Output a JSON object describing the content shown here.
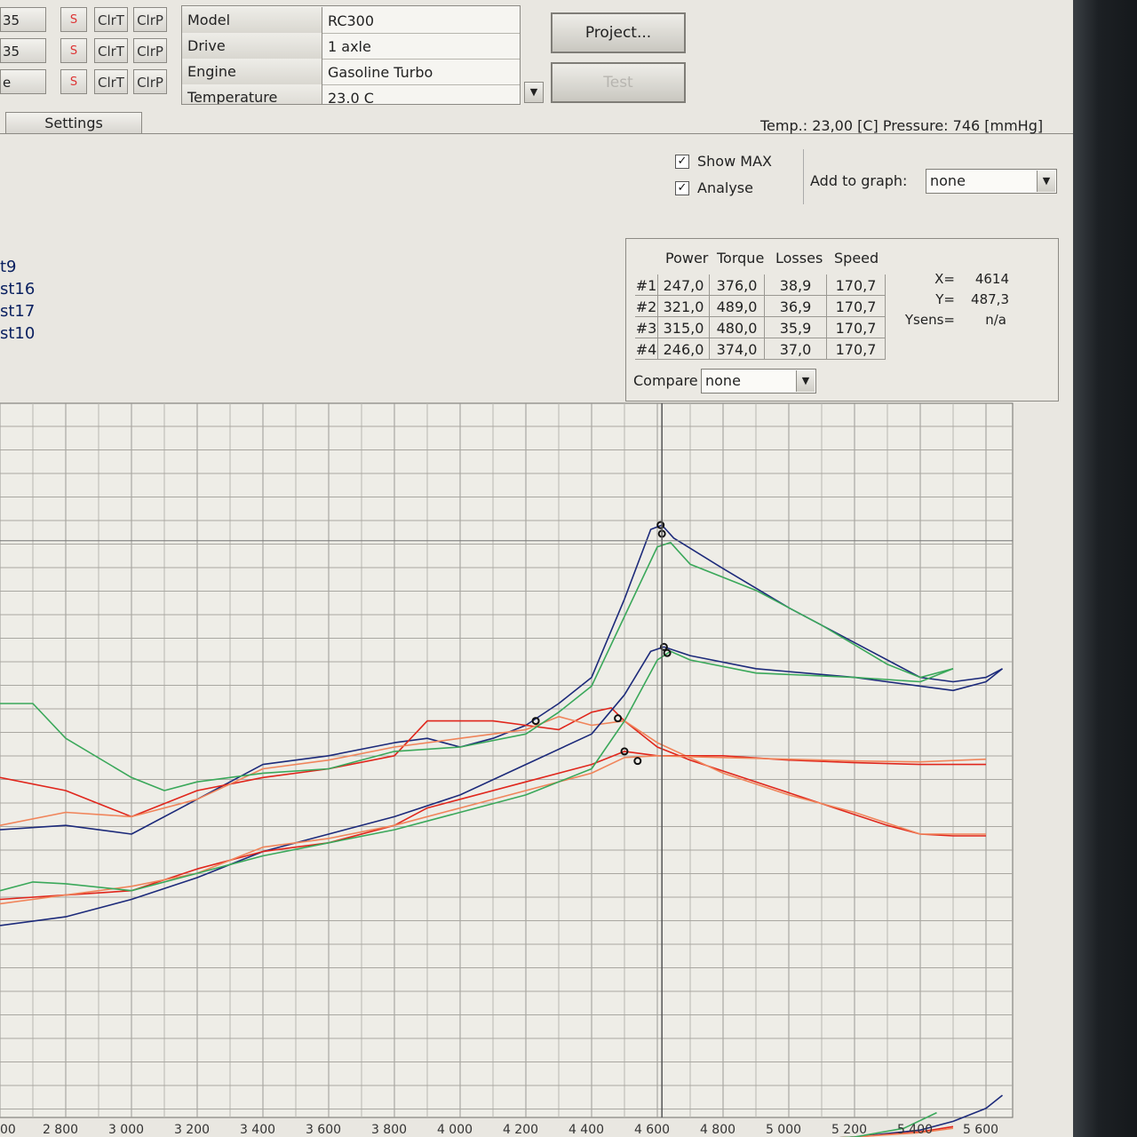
{
  "channels": [
    {
      "name": "35",
      "s": "S",
      "clrt": "ClrT",
      "clrp": "ClrP"
    },
    {
      "name": "35",
      "s": "S",
      "clrt": "ClrT",
      "clrp": "ClrP"
    },
    {
      "name": "e",
      "s": "S",
      "clrt": "ClrT",
      "clrp": "ClrP"
    }
  ],
  "vehicle_info": [
    {
      "key": "Model",
      "value": "RC300"
    },
    {
      "key": "Drive",
      "value": "1 axle"
    },
    {
      "key": "Engine",
      "value": "Gasoline Turbo"
    },
    {
      "key": "Temperature",
      "value": "23.0 C"
    }
  ],
  "buttons": {
    "project": "Project...",
    "test": "Test"
  },
  "tabs": {
    "settings": "Settings"
  },
  "status": {
    "text": "Temp.: 23,00 [C]  Pressure: 746 [mmHg]"
  },
  "options": {
    "show_max": {
      "label": "Show MAX",
      "checked": "✓"
    },
    "analyse": {
      "label": "Analyse",
      "checked": "✓"
    },
    "add_to_graph_label": "Add to graph:",
    "add_to_graph_value": "none"
  },
  "legend": [
    "t9",
    "st16",
    "st17",
    "st10"
  ],
  "analysis": {
    "headers": [
      "Power",
      "Torque",
      "Losses",
      "Speed"
    ],
    "rows": [
      {
        "id": "#1",
        "power": "247,0",
        "torque": "376,0",
        "losses": "38,9",
        "speed": "170,7"
      },
      {
        "id": "#2",
        "power": "321,0",
        "torque": "489,0",
        "losses": "36,9",
        "speed": "170,7"
      },
      {
        "id": "#3",
        "power": "315,0",
        "torque": "480,0",
        "losses": "35,9",
        "speed": "170,7"
      },
      {
        "id": "#4",
        "power": "246,0",
        "torque": "374,0",
        "losses": "37,0",
        "speed": "170,7"
      }
    ],
    "x_label": "X=",
    "x_value": "4614",
    "y_label": "Y=",
    "y_value": "487,3",
    "ysens_label": "Ysens=",
    "ysens_value": "n/a",
    "compare_label": "Compare",
    "compare_value": "none"
  },
  "icons": {
    "dropdown": "▼"
  },
  "chart_data": {
    "type": "line",
    "x_ticks": [
      "00",
      "2 800",
      "3 000",
      "3 200",
      "3 400",
      "3 600",
      "3 800",
      "4 000",
      "4 200",
      "4 400",
      "4 600",
      "4 800",
      "5 000",
      "5 200",
      "5 400",
      "5 600"
    ],
    "cursor_x": 4614,
    "grid": true,
    "series": [
      {
        "color": "#1c2a7a",
        "group": "torque",
        "x": [
          2600,
          2800,
          3000,
          3200,
          3400,
          3600,
          3800,
          3900,
          4000,
          4100,
          4200,
          4300,
          4400,
          4500,
          4580,
          4614,
          4650,
          4800,
          5000,
          5200,
          5400,
          5500,
          5600,
          5650
        ],
        "y": [
          155,
          160,
          150,
          190,
          230,
          240,
          255,
          260,
          250,
          260,
          275,
          300,
          330,
          420,
          500,
          505,
          490,
          455,
          410,
          370,
          330,
          325,
          330,
          340
        ]
      },
      {
        "color": "#e0261c",
        "group": "torque",
        "x": [
          2600,
          2800,
          3000,
          3200,
          3400,
          3600,
          3800,
          3900,
          4000,
          4100,
          4200,
          4300,
          4400,
          4460,
          4500,
          4600,
          4700,
          4900,
          5100,
          5300,
          5400,
          5500,
          5600
        ],
        "y": [
          215,
          200,
          170,
          200,
          215,
          225,
          240,
          280,
          280,
          280,
          275,
          270,
          290,
          295,
          280,
          250,
          235,
          210,
          185,
          160,
          150,
          148,
          148
        ]
      },
      {
        "color": "#f0845a",
        "group": "torque",
        "x": [
          2600,
          2800,
          3000,
          3200,
          3400,
          3600,
          3800,
          4000,
          4200,
          4300,
          4400,
          4500,
          4600,
          4800,
          5000,
          5200,
          5400,
          5500,
          5600
        ],
        "y": [
          160,
          175,
          170,
          190,
          225,
          235,
          250,
          260,
          270,
          285,
          275,
          280,
          255,
          220,
          195,
          175,
          150,
          150,
          150
        ]
      },
      {
        "color": "#3aa85a",
        "group": "torque",
        "x": [
          2600,
          2700,
          2800,
          3000,
          3100,
          3200,
          3400,
          3600,
          3800,
          4000,
          4200,
          4300,
          4400,
          4500,
          4600,
          4640,
          4700,
          4900,
          5100,
          5300,
          5400,
          5500
        ],
        "y": [
          300,
          300,
          260,
          215,
          200,
          210,
          220,
          225,
          245,
          250,
          265,
          290,
          320,
          400,
          480,
          485,
          460,
          430,
          390,
          345,
          330,
          340
        ]
      },
      {
        "color": "#1c2a7a",
        "group": "power",
        "x": [
          2600,
          2800,
          3000,
          3200,
          3400,
          3600,
          3800,
          4000,
          4200,
          4400,
          4500,
          4580,
          4620,
          4700,
          4900,
          5200,
          5400,
          5500,
          5600,
          5650
        ],
        "y": [
          45,
          55,
          75,
          100,
          130,
          150,
          170,
          195,
          230,
          265,
          310,
          360,
          365,
          355,
          340,
          330,
          320,
          315,
          325,
          340
        ]
      },
      {
        "color": "#e0261c",
        "group": "power",
        "x": [
          2600,
          2800,
          3000,
          3200,
          3400,
          3600,
          3800,
          3900,
          4000,
          4200,
          4400,
          4500,
          4600,
          4800,
          5000,
          5200,
          5400,
          5600
        ],
        "y": [
          75,
          80,
          85,
          110,
          130,
          140,
          160,
          180,
          190,
          210,
          230,
          245,
          240,
          240,
          235,
          232,
          230,
          230
        ]
      },
      {
        "color": "#f0845a",
        "group": "power",
        "x": [
          2600,
          2800,
          3000,
          3200,
          3400,
          3600,
          3800,
          4000,
          4200,
          4400,
          4500,
          4600,
          4800,
          5000,
          5200,
          5400,
          5600
        ],
        "y": [
          70,
          80,
          90,
          105,
          135,
          145,
          160,
          180,
          200,
          220,
          238,
          240,
          238,
          236,
          234,
          233,
          236
        ]
      },
      {
        "color": "#3aa85a",
        "group": "power",
        "x": [
          2600,
          2700,
          2800,
          3000,
          3200,
          3400,
          3600,
          3800,
          4000,
          4200,
          4400,
          4500,
          4600,
          4640,
          4700,
          4900,
          5200,
          5400,
          5500
        ],
        "y": [
          85,
          95,
          93,
          85,
          105,
          125,
          140,
          155,
          175,
          195,
          225,
          280,
          350,
          360,
          350,
          335,
          330,
          325,
          340
        ]
      },
      {
        "color": "#1c2a7a",
        "group": "losses",
        "x": [
          2600,
          3200,
          3800,
          4400,
          4800,
          5200,
          5400,
          5500,
          5600,
          5650
        ],
        "y": [
          -240,
          -230,
          -220,
          -210,
          -205,
          -198,
          -190,
          -180,
          -165,
          -150
        ]
      },
      {
        "color": "#e0261c",
        "group": "losses",
        "x": [
          2600,
          3200,
          3800,
          4400,
          4800,
          5200,
          5400,
          5500
        ],
        "y": [
          -240,
          -230,
          -220,
          -210,
          -205,
          -198,
          -192,
          -186
        ]
      },
      {
        "color": "#f0845a",
        "group": "losses",
        "x": [
          2600,
          3200,
          3800,
          4400,
          4800,
          5200,
          5400,
          5500
        ],
        "y": [
          -240,
          -230,
          -220,
          -210,
          -205,
          -198,
          -193,
          -188
        ]
      },
      {
        "color": "#3aa85a",
        "group": "losses",
        "x": [
          2600,
          3200,
          3800,
          4400,
          4800,
          5200,
          5350,
          5450
        ],
        "y": [
          -240,
          -230,
          -220,
          -210,
          -205,
          -198,
          -188,
          -170
        ]
      }
    ]
  }
}
